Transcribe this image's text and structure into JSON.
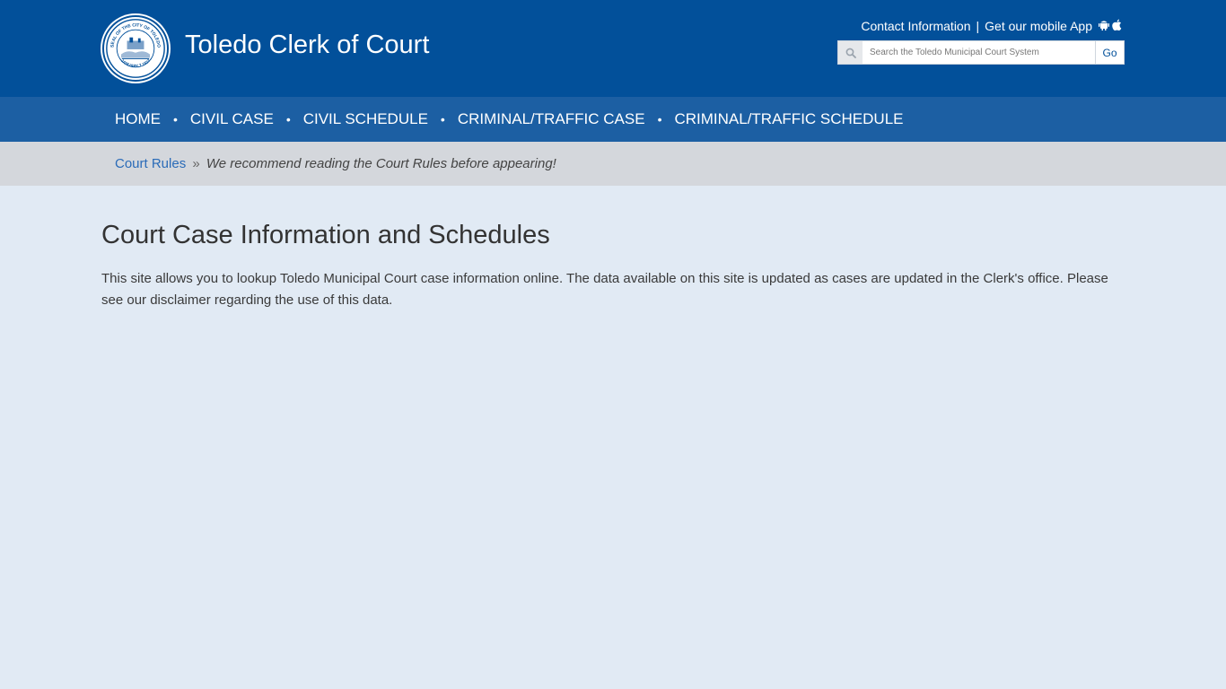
{
  "header": {
    "title": "Toledo Clerk of Court",
    "seal_text_top": "SEAL OF THE CITY OF TOLEDO",
    "seal_text_bottom": "JANUARY 7 1837",
    "contact_link": "Contact Information",
    "separator": "|",
    "mobile_app_link": "Get our mobile App",
    "search": {
      "placeholder": "Search the Toledo Municipal Court System",
      "go_label": "Go"
    }
  },
  "nav": {
    "items": [
      {
        "label": "HOME"
      },
      {
        "label": "CIVIL CASE"
      },
      {
        "label": "CIVIL SCHEDULE"
      },
      {
        "label": "CRIMINAL/TRAFFIC CASE"
      },
      {
        "label": "CRIMINAL/TRAFFIC SCHEDULE"
      }
    ],
    "separator": "•"
  },
  "breadcrumb": {
    "link": "Court Rules",
    "separator": "»",
    "note": "We recommend reading the Court Rules before appearing!"
  },
  "main": {
    "heading": "Court Case Information and Schedules",
    "body": "This site allows you to lookup Toledo Municipal Court case information online. The data available on this site is updated as cases are updated in the Clerk's office. Please see our disclaimer regarding the use of this data."
  },
  "colors": {
    "header_bg": "#02509a",
    "nav_bg": "#1c5fa3",
    "breadcrumb_bg": "#d4d7dc",
    "page_bg": "#e1eaf4",
    "link": "#2a6bb8"
  },
  "icons": [
    "city-seal-logo",
    "search-icon",
    "android-icon",
    "apple-icon"
  ]
}
